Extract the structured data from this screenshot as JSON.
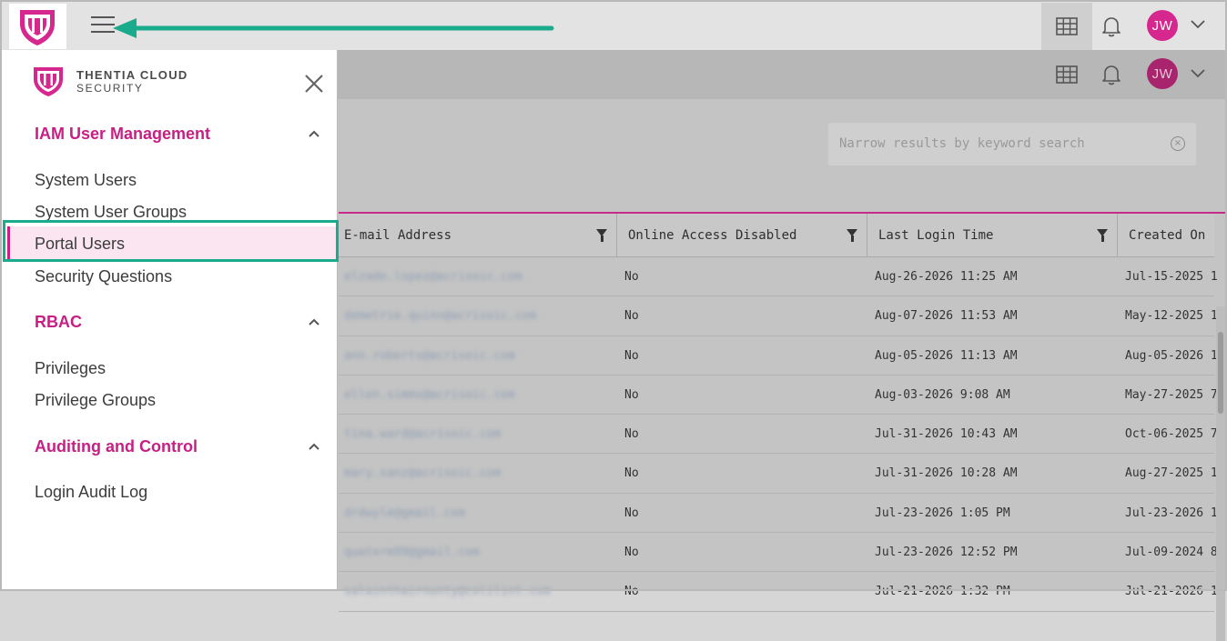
{
  "header": {
    "menu_icon": "hamburger-menu-icon",
    "grid_icon": "grid-icon",
    "bell_icon": "bell-icon",
    "avatar_initials": "JW"
  },
  "sidebar": {
    "brand_line1": "THENTIA CLOUD",
    "brand_line2": "SECURITY",
    "sections": [
      {
        "title": "IAM User Management",
        "items": [
          "System Users",
          "System User Groups",
          "Portal Users",
          "Security Questions"
        ]
      },
      {
        "title": "RBAC",
        "items": [
          "Privileges",
          "Privilege Groups"
        ]
      },
      {
        "title": "Auditing and Control",
        "items": [
          "Login Audit Log"
        ]
      }
    ],
    "active_item": "Portal Users"
  },
  "search": {
    "placeholder": "Narrow results by keyword search"
  },
  "table": {
    "columns": [
      "E-mail Address",
      "Online Access Disabled",
      "Last Login Time",
      "Created On"
    ],
    "rows": [
      {
        "email": "elzade.lopez@acrisoic.com",
        "disabled": "No",
        "last_login": "Aug-26-2026 11:25 AM",
        "created": "Jul-15-2025 1"
      },
      {
        "email": "demetrie.quinn@acrisoic.com",
        "disabled": "No",
        "last_login": "Aug-07-2026 11:53 AM",
        "created": "May-12-2025 1"
      },
      {
        "email": "ann.roberts@acrisoic.com",
        "disabled": "No",
        "last_login": "Aug-05-2026 11:13 AM",
        "created": "Aug-05-2026 1"
      },
      {
        "email": "ellen.simms@acrisoic.com",
        "disabled": "No",
        "last_login": "Aug-03-2026 9:08 AM",
        "created": "May-27-2025 7"
      },
      {
        "email": "tina.ward@acrisoic.com",
        "disabled": "No",
        "last_login": "Jul-31-2026 10:43 AM",
        "created": "Oct-06-2025 7"
      },
      {
        "email": "mary.sanz@acrisoic.com",
        "disabled": "No",
        "last_login": "Jul-31-2026 10:28 AM",
        "created": "Aug-27-2025 1"
      },
      {
        "email": "drdwyle@gmail.com",
        "disabled": "No",
        "last_login": "Jul-23-2026 1:05 PM",
        "created": "Jul-23-2026 1"
      },
      {
        "email": "quaterm99@gmail.com",
        "disabled": "No",
        "last_login": "Jul-23-2026 12:52 PM",
        "created": "Jul-09-2024 8"
      },
      {
        "email": "salainthairnunty@colilint.com",
        "disabled": "No",
        "last_login": "Jul-21-2026 1:32 PM",
        "created": "Jul-21-2026 1"
      }
    ]
  },
  "colors": {
    "brand": "#c71f84",
    "annotation": "#1aaa8c"
  }
}
